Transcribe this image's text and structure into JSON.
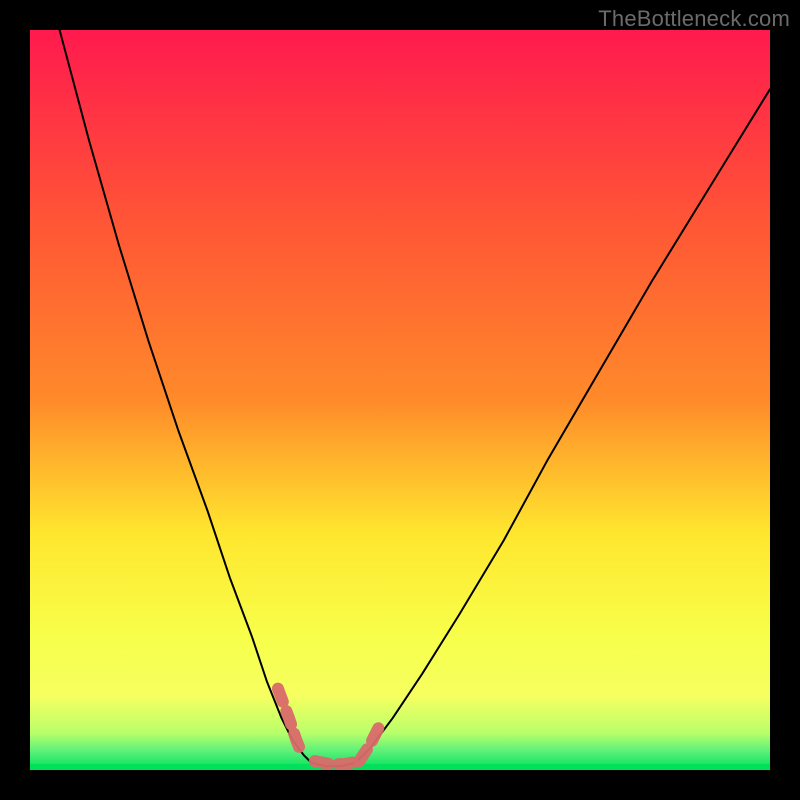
{
  "watermark": "TheBottleneck.com",
  "chart_data": {
    "type": "line",
    "title": "",
    "xlabel": "",
    "ylabel": "",
    "xlim": [
      0,
      100
    ],
    "ylim": [
      0,
      100
    ],
    "grid": false,
    "legend": null,
    "background_gradient": {
      "top": "#ff1a4e",
      "mid_upper": "#ff8a2a",
      "mid": "#ffe62e",
      "mid_lower": "#f6ff60",
      "lower": "#b8ff6a",
      "bottom": "#00e05a"
    },
    "series": [
      {
        "name": "left-curve",
        "color": "#000000",
        "stroke_width": 2,
        "x": [
          4,
          8,
          12,
          16,
          20,
          24,
          27,
          30,
          32,
          34,
          35.5,
          37,
          38
        ],
        "y": [
          100,
          85,
          71,
          58,
          46,
          35,
          26,
          18,
          12,
          7,
          4,
          2,
          1
        ]
      },
      {
        "name": "right-curve",
        "color": "#000000",
        "stroke_width": 2,
        "x": [
          44,
          46,
          49,
          53,
          58,
          64,
          70,
          77,
          84,
          92,
          100
        ],
        "y": [
          1,
          3,
          7,
          13,
          21,
          31,
          42,
          54,
          66,
          79,
          92
        ]
      },
      {
        "name": "floor",
        "color": "#000000",
        "stroke_width": 2,
        "x": [
          38,
          40,
          42,
          44
        ],
        "y": [
          1,
          0.5,
          0.5,
          1
        ]
      }
    ],
    "highlight": {
      "color": "#d96a6a",
      "stroke_width": 12,
      "segments": [
        {
          "name": "left-tail",
          "x": [
            33.5,
            35,
            36,
            36.8
          ],
          "y": [
            11,
            7,
            4,
            2
          ]
        },
        {
          "name": "floor-dots",
          "x": [
            38.5,
            40.5,
            42.5,
            44.5
          ],
          "y": [
            1.2,
            0.8,
            0.8,
            1.2
          ]
        },
        {
          "name": "right-tail",
          "x": [
            44.5,
            46,
            47.5
          ],
          "y": [
            1.2,
            3.5,
            6.5
          ]
        }
      ]
    }
  }
}
